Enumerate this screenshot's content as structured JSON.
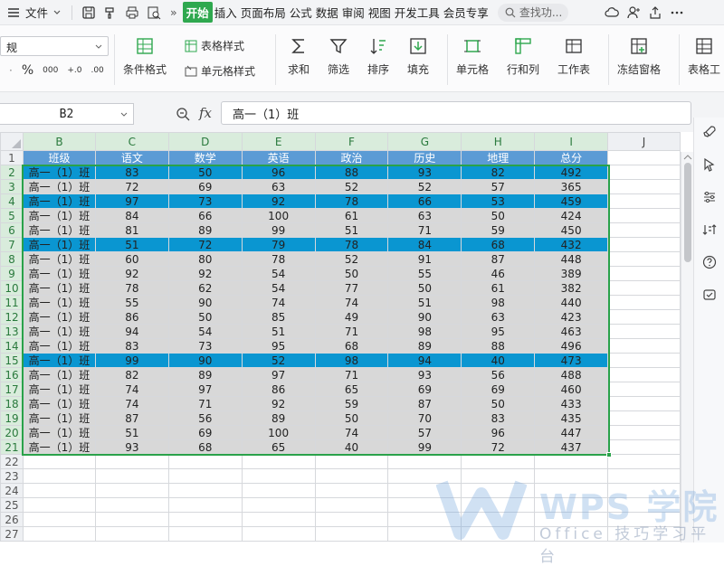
{
  "menubar": {
    "file_label": "文件",
    "more_label": "»",
    "tabs": [
      "开始",
      "插入",
      "页面布局",
      "公式",
      "数据",
      "审阅",
      "视图",
      "开发工具",
      "会员专享"
    ],
    "active_tab": "开始",
    "search_placeholder": "查找功..."
  },
  "ribbon": {
    "font_combo_value": "规",
    "percent": "%",
    "thousands": "000",
    "dec_inc": "+.0",
    "dec_dec": ".00",
    "conditional_format": "条件格式",
    "table_style": "表格样式",
    "cell_style": "单元格样式",
    "sum": "求和",
    "filter": "筛选",
    "sort": "排序",
    "fill": "填充",
    "cell": "单元格",
    "row_col": "行和列",
    "worksheet": "工作表",
    "freeze": "冻结窗格",
    "table_tools": "表格工"
  },
  "formula_bar": {
    "cell_ref": "B2",
    "fx_label": "fx",
    "content": "高一（1）班"
  },
  "sheet": {
    "columns": [
      "B",
      "C",
      "D",
      "E",
      "F",
      "G",
      "H",
      "I",
      "J"
    ],
    "headers": [
      "班级",
      "语文",
      "数学",
      "英语",
      "政治",
      "历史",
      "地理",
      "总分"
    ],
    "rows": [
      {
        "class": "高一（1）班",
        "scores": [
          "83",
          "50",
          "96",
          "88",
          "93",
          "82",
          "492"
        ],
        "style": "blue"
      },
      {
        "class": "高一（1）班",
        "scores": [
          "72",
          "69",
          "63",
          "52",
          "52",
          "57",
          "365"
        ],
        "style": "gray"
      },
      {
        "class": "高一（1）班",
        "scores": [
          "97",
          "73",
          "92",
          "78",
          "66",
          "53",
          "459"
        ],
        "style": "blue"
      },
      {
        "class": "高一（1）班",
        "scores": [
          "84",
          "66",
          "100",
          "61",
          "63",
          "50",
          "424"
        ],
        "style": "gray"
      },
      {
        "class": "高一（1）班",
        "scores": [
          "81",
          "89",
          "99",
          "51",
          "71",
          "59",
          "450"
        ],
        "style": "gray"
      },
      {
        "class": "高一（1）班",
        "scores": [
          "51",
          "72",
          "79",
          "78",
          "84",
          "68",
          "432"
        ],
        "style": "blue"
      },
      {
        "class": "高一（1）班",
        "scores": [
          "60",
          "80",
          "78",
          "52",
          "91",
          "87",
          "448"
        ],
        "style": "gray"
      },
      {
        "class": "高一（1）班",
        "scores": [
          "92",
          "92",
          "54",
          "50",
          "55",
          "46",
          "389"
        ],
        "style": "gray"
      },
      {
        "class": "高一（1）班",
        "scores": [
          "78",
          "62",
          "54",
          "77",
          "50",
          "61",
          "382"
        ],
        "style": "gray"
      },
      {
        "class": "高一（1）班",
        "scores": [
          "55",
          "90",
          "74",
          "74",
          "51",
          "98",
          "440"
        ],
        "style": "gray"
      },
      {
        "class": "高一（1）班",
        "scores": [
          "86",
          "50",
          "85",
          "49",
          "90",
          "63",
          "423"
        ],
        "style": "gray"
      },
      {
        "class": "高一（1）班",
        "scores": [
          "94",
          "54",
          "51",
          "71",
          "98",
          "95",
          "463"
        ],
        "style": "gray"
      },
      {
        "class": "高一（1）班",
        "scores": [
          "83",
          "73",
          "95",
          "68",
          "89",
          "88",
          "496"
        ],
        "style": "gray"
      },
      {
        "class": "高一（1）班",
        "scores": [
          "99",
          "90",
          "52",
          "98",
          "94",
          "40",
          "473"
        ],
        "style": "blue"
      },
      {
        "class": "高一（1）班",
        "scores": [
          "82",
          "89",
          "97",
          "71",
          "93",
          "56",
          "488"
        ],
        "style": "gray"
      },
      {
        "class": "高一（1）班",
        "scores": [
          "74",
          "97",
          "86",
          "65",
          "69",
          "69",
          "460"
        ],
        "style": "gray"
      },
      {
        "class": "高一（1）班",
        "scores": [
          "74",
          "71",
          "92",
          "59",
          "87",
          "50",
          "433"
        ],
        "style": "gray"
      },
      {
        "class": "高一（1）班",
        "scores": [
          "87",
          "56",
          "89",
          "50",
          "70",
          "83",
          "435"
        ],
        "style": "gray"
      },
      {
        "class": "高一（1）班",
        "scores": [
          "51",
          "69",
          "100",
          "74",
          "57",
          "96",
          "447"
        ],
        "style": "gray"
      },
      {
        "class": "高一（1）班",
        "scores": [
          "93",
          "68",
          "65",
          "40",
          "99",
          "72",
          "437"
        ],
        "style": "gray"
      }
    ],
    "row_numbers": [
      "1",
      "2",
      "3",
      "4",
      "5",
      "6",
      "7",
      "8",
      "9",
      "10",
      "11",
      "12",
      "13",
      "14",
      "15",
      "16",
      "17",
      "18",
      "19",
      "20",
      "21",
      "22",
      "23",
      "24",
      "25",
      "26",
      "27"
    ]
  },
  "colors": {
    "accent_green": "#2fa84f",
    "header_blue": "#5b9bd5",
    "row_blue": "#0a96d1",
    "row_gray": "#d8d8d8"
  },
  "watermark": {
    "brand": "WPS 学院",
    "sub": "Office 技巧学习平台"
  }
}
